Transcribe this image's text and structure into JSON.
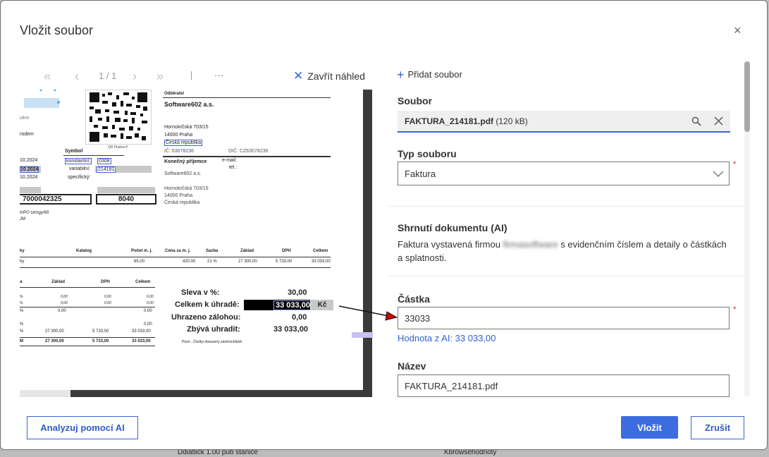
{
  "dialog": {
    "title": "Vložit soubor",
    "close_glyph": "×"
  },
  "preview_toolbar": {
    "first_glyph": "«",
    "prev_glyph": "‹",
    "page": "1 / 1",
    "next_glyph": "›",
    "last_glyph": "»",
    "more_glyph": "···",
    "close_preview_label": "Zavřít náhled"
  },
  "invoice": {
    "logo_tail": "ufirm",
    "od": "rodem",
    "qr_label": "QR Platba+F",
    "odberatel_label": "Odběratel",
    "customer_name": "Software602 a.s.",
    "customer_street": "Hornokrčská 703/15",
    "customer_city": "14000  Praha",
    "customer_country": "Česká republika",
    "ic": "IČ: 63078236",
    "dic": "DIČ: CZ63078236",
    "symbol_label": "Symbol",
    "konstantni_label": "konstantní:",
    "konstantni_value": "0308",
    "variabilni_label": "variabilní:",
    "variabilni_value": "214181",
    "specificky_label": "specifický:",
    "date1": "10.2024",
    "date2": "10.2024",
    "date3": "10.2024",
    "email_label": "e-mail:",
    "tel_label": "tel.:",
    "konecny_label": "Konečný příjemce",
    "final_name": "Software602 a.s.",
    "final_street": "Hornokrčská 703/15",
    "final_city": "14000  Praha",
    "final_country": "Česká republika",
    "account_value": "7000042325",
    "bank_code": "8040",
    "note_line1": "h/PO stringy/65",
    "note_line2": "JM",
    "col_ky": "ky",
    "col_katalog": "Katalog",
    "col_pocet": "Počet  m. j.",
    "col_cena": "Cena za m. j.",
    "col_sazba": "Sazba",
    "col_zaklad": "Základ",
    "col_dph": "DPH",
    "col_celkem": "Celkem",
    "row_by": "by",
    "row_pocet": "65,00",
    "row_cena": "420,00",
    "row_sazba": "21  %",
    "row_zaklad": "27 300,00",
    "row_dph": "5 733,00",
    "row_celkem": "33 033,00",
    "sum_col_a": "a",
    "sum_col_zaklad": "Základ",
    "sum_col_dph": "DPH",
    "sum_col_celkem": "Celkem",
    "pct": "%",
    "zero_small": "0,00",
    "sum_zero_a": "0,00",
    "sum_zero_c": "0,00",
    "sum_zero_b": "0,00",
    "sum_zaklad": "27 300,00",
    "sum_dph": "5 733,00",
    "sum_celkem": "33 033,00",
    "sum_total_label": "M",
    "sum_total_zaklad": "27 300,00",
    "sum_total_dph": "5 733,00",
    "sum_total_celkem": "33 033,00",
    "sleva_label": "Sleva v %:",
    "sleva_value": "30,00",
    "celkem_label": "Celkem k úhradě:",
    "celkem_value": "33 033,00",
    "currency": "Kč",
    "uhrazeno_label": "Uhrazeno zálohou:",
    "uhrazeno_value": "0,00",
    "zbyva_label": "Zbývá uhradit:",
    "zbyva_value": "33 033,00",
    "footnote": "Pozn.: Částky dosazeny zaokrouhleně."
  },
  "right_panel": {
    "add_file_label": "Přidat soubor",
    "soubor_label": "Soubor",
    "file_name": "FAKTURA_214181.pdf",
    "file_size": "(120 kB)",
    "typ_label": "Typ souboru",
    "typ_value": "Faktura",
    "shrnuti_label": "Shrnutí dokumentu (AI)",
    "summary_before": "Faktura vystavená firmou",
    "summary_blurred": "firmasoftware",
    "summary_after": " s evidenčním číslem a detaily o částkách a splatnosti.",
    "castka_label": "Částka",
    "castka_value": "33033",
    "ai_hint": "Hodnota z AI: 33 033,00",
    "nazev_label": "Název",
    "nazev_value": "FAKTURA_214181.pdf",
    "required_mark": "*"
  },
  "footer": {
    "analyze_label": "Analyzuj pomocí AI",
    "insert_label": "Vložit",
    "cancel_label": "Zrušit"
  },
  "colors": {
    "accent": "#3b63d6",
    "primary_button": "#3d6be0",
    "link": "#2f63d2",
    "required": "#dd2222"
  },
  "underlay": {
    "text_a": "Ddiatlick 1.00 pub stanice",
    "text_b": "Kbrowsehodnoty"
  }
}
